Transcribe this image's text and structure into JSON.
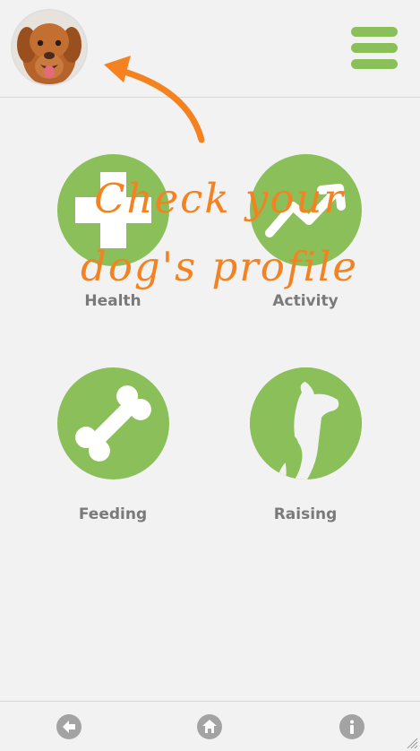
{
  "header": {
    "avatar_alt": "dog profile photo",
    "menu_icon": "hamburger-icon"
  },
  "tiles": [
    {
      "label": "Health",
      "icon": "medical-cross-icon"
    },
    {
      "label": "Activity",
      "icon": "trend-up-icon"
    },
    {
      "label": "Feeding",
      "icon": "bone-icon"
    },
    {
      "label": "Raising",
      "icon": "dog-and-puppy-icon"
    }
  ],
  "callout": {
    "line1": "Check your",
    "line2": "dog's profile"
  },
  "bottom_nav": {
    "back_icon": "back-arrow-icon",
    "home_icon": "home-icon",
    "info_icon": "info-icon"
  },
  "colors": {
    "accent": "#8bbf5a",
    "callout": "#f58220",
    "label": "#7a7a7a",
    "background": "#f2f2f2",
    "nav_icon": "#a3a3a3"
  }
}
